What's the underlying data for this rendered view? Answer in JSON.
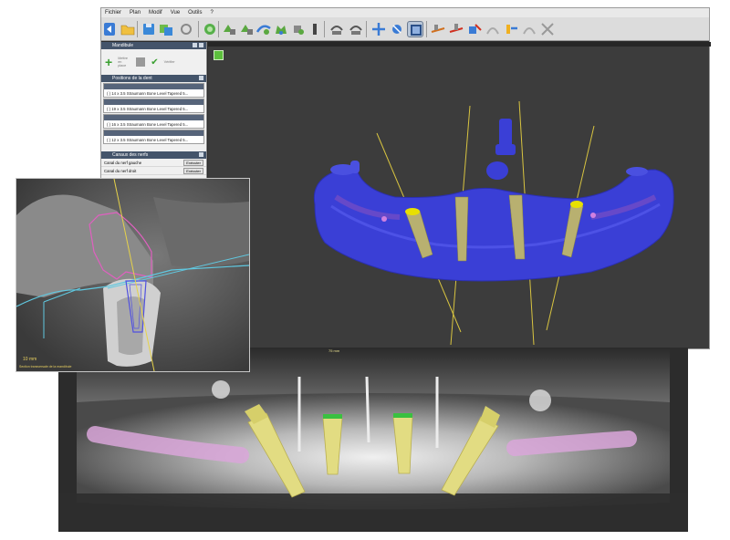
{
  "menubar": {
    "items": [
      "Fichier",
      "Plan",
      "Modif",
      "Vue",
      "Outils",
      "?"
    ]
  },
  "left_panel": {
    "header_mandibule": "Mandibule",
    "action_labels": [
      "Mettre en place",
      "Vérifier"
    ],
    "header_positions": "Positions de la dent",
    "implants": [
      "( ) 14 x 3.5  Straumann Bone Level Tapered 5...",
      "( ) 19 x 3.5  Straumann Bone Level Tapered 5...",
      "( ) 16 x 3.5  Straumann Bone Level Tapered 5...",
      "( ) 12 x 3.5  Straumann Bone Level Tapered 5..."
    ],
    "header_canals": "Canaux des nerfs",
    "canals": [
      {
        "label": "Canal du nerf gauche",
        "button": "Exécuter"
      },
      {
        "label": "Canal du nerf droit",
        "button": "Exécuter"
      }
    ]
  },
  "view3d": {
    "icon": "view-icon"
  },
  "pano": {
    "label": "75 mm"
  },
  "ct": {
    "scale": "10 mm",
    "caption": "Section transversale de la mandibule"
  },
  "colors": {
    "jaw": "#3a3fd6",
    "implant": "#d6d07a",
    "implant_top": "#e8e000",
    "axis": "#e6d24a",
    "nerve": "#d9a6d9",
    "ct_outline": "#e060c0",
    "ct_line": "#60c8e0",
    "toolbar_bg": "#dcdcdc",
    "panel_header": "#44546a"
  },
  "icons": [
    "back-arrow-icon",
    "open-folder-icon",
    "save-icon",
    "layers-icon",
    "refresh-icon",
    "tooth-icon",
    "implant-icon",
    "measure-icon",
    "nerve-icon",
    "crown-icon",
    "cursor-icon",
    "rotate-icon",
    "view-icon",
    "cut-icon"
  ]
}
